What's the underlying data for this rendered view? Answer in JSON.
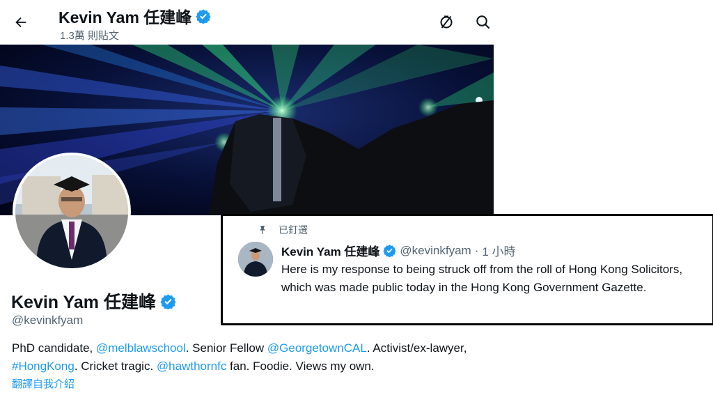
{
  "header": {
    "name": "Kevin Yam 任建峰",
    "post_count": "1.3萬 則貼文"
  },
  "profile": {
    "name": "Kevin Yam 任建峰",
    "handle": "@kevinkfyam",
    "bio": {
      "t1": "PhD candidate, ",
      "m1": "@melblawschool",
      "t2": ". Senior Fellow ",
      "m2": "@GeorgetownCAL",
      "t3": ". Activist/ex-lawyer, ",
      "m3": "#HongKong",
      "t4": ". Cricket tragic. ",
      "m4": "@hawthornfc",
      "t5": " fan. Foodie. Views my own."
    },
    "translate": "翻譯自我介紹"
  },
  "pinned_tweet": {
    "pinned_label": "已釘選",
    "name": "Kevin Yam 任建峰",
    "handle": "@kevinkfyam",
    "separator": " · ",
    "time": "1 小時",
    "text": "Here is my response to being struck off from the roll of Hong Kong Solicitors, which was made public today in the Hong Kong Government Gazette."
  },
  "colors": {
    "accent": "#1d9bf0",
    "text": "#0f1419",
    "muted": "#536471"
  },
  "icons": [
    "back-arrow-icon",
    "verified-badge-icon",
    "no-notifications-icon",
    "search-icon",
    "pin-icon"
  ]
}
